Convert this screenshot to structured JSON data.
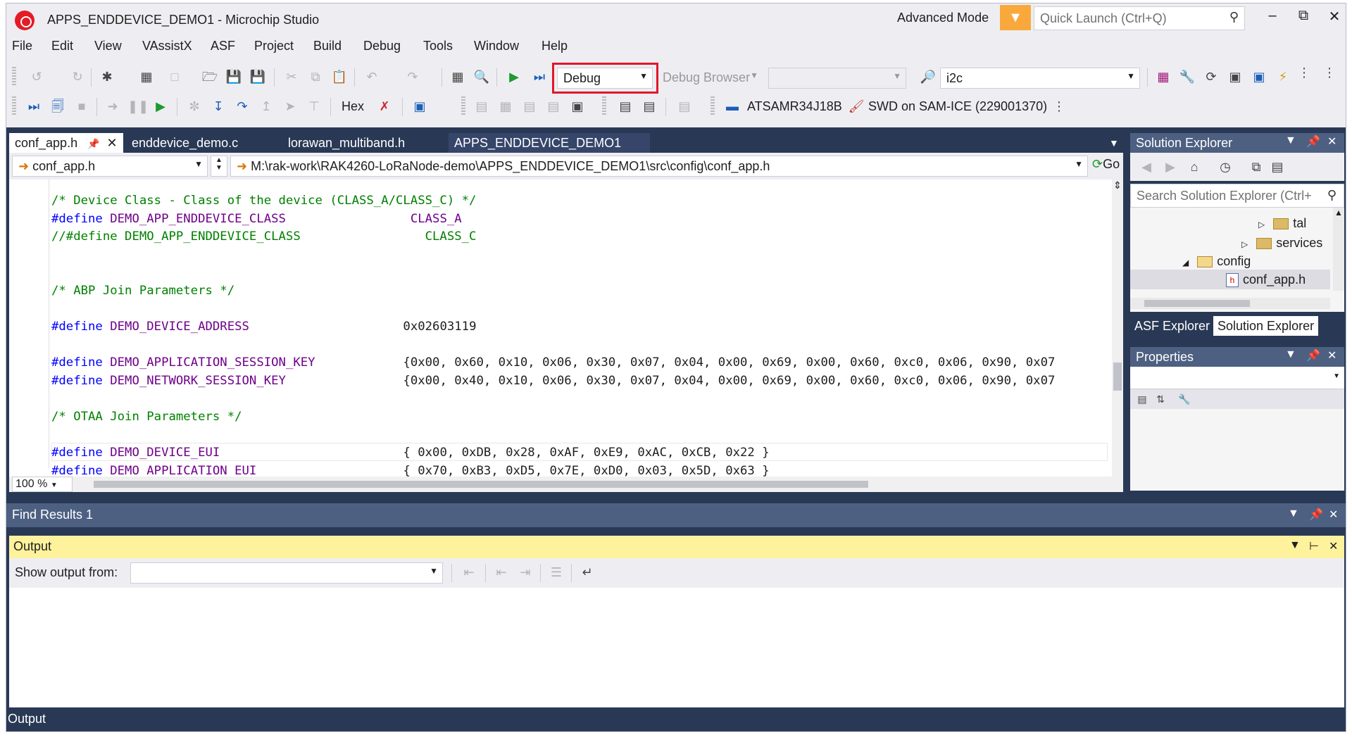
{
  "window": {
    "title": "APPS_ENDDEVICE_DEMO1 - Microchip Studio",
    "mode": "Advanced Mode",
    "quick_launch_placeholder": "Quick Launch (Ctrl+Q)",
    "controls": [
      "–",
      "⧉",
      "✕"
    ]
  },
  "menu": [
    "File",
    "Edit",
    "View",
    "VAssistX",
    "ASF",
    "Project",
    "Build",
    "Debug",
    "Tools",
    "Window",
    "Help"
  ],
  "toolbar": {
    "config_value": "Debug",
    "debug_browser_label": "Debug Browser",
    "search_value": "i2c",
    "hex_label": "Hex",
    "device": "ATSAMR34J18B",
    "tool": "SWD on SAM-ICE (229001370)"
  },
  "editor": {
    "tabs": [
      "conf_app.h",
      "enddevice_demo.c",
      "lorawan_multiband.h",
      "APPS_ENDDEVICE_DEMO1"
    ],
    "nav_file": "conf_app.h",
    "nav_path": "M:\\rak-work\\RAK4260-LoRaNode-demo\\APPS_ENDDEVICE_DEMO1\\src\\config\\conf_app.h",
    "go_label": "Go",
    "zoom": "100 %",
    "code": {
      "l1": "/* Device Class - Class of the device (CLASS_A/CLASS_C) */",
      "l2a": "#define",
      "l2b": " DEMO_APP_ENDDEVICE_CLASS",
      "l2c": "                 CLASS_A",
      "l3": "//#define DEMO_APP_ENDDEVICE_CLASS                 CLASS_C",
      "l6": "/* ABP Join Parameters */",
      "l8a": "#define",
      "l8b": " DEMO_DEVICE_ADDRESS",
      "l8c": "                     0x02603119",
      "l10a": "#define",
      "l10b": " DEMO_APPLICATION_SESSION_KEY",
      "l10c": "            {0x00, 0x60, 0x10, 0x06, 0x30, 0x07, 0x04, 0x00, 0x69, 0x00, 0x60, 0xc0, 0x06, 0x90, 0x07",
      "l11a": "#define",
      "l11b": " DEMO_NETWORK_SESSION_KEY",
      "l11c": "                {0x00, 0x40, 0x10, 0x06, 0x30, 0x07, 0x04, 0x00, 0x69, 0x00, 0x60, 0xc0, 0x06, 0x90, 0x07",
      "l13": "/* OTAA Join Parameters */",
      "l15a": "#define",
      "l15b": " DEMO_DEVICE_EUI",
      "l15c": "                         { 0x00, 0xDB, 0x28, 0xAF, 0xE9, 0xAC, 0xCB, 0x22 }",
      "l16a": "#define",
      "l16b": " DEMO_APPLICATION_EUI",
      "l16c": "                    { 0x70, 0xB3, 0xD5, 0x7E, 0xD0, 0x03, 0x5D, 0x63 }"
    }
  },
  "solution_explorer": {
    "title": "Solution Explorer",
    "search_placeholder": "Search Solution Explorer (Ctrl+",
    "tree": [
      "tal",
      "services",
      "config",
      "conf_app.h"
    ],
    "tabs": [
      "ASF Explorer",
      "Solution Explorer"
    ]
  },
  "properties": {
    "title": "Properties"
  },
  "find_results": {
    "title": "Find Results 1"
  },
  "output": {
    "title": "Output",
    "show_from_label": "Show output from:",
    "bottom_tab": "Output"
  },
  "colors": {
    "accent": "#293955",
    "highlight": "#e3162b",
    "output_header": "#fff29d"
  }
}
